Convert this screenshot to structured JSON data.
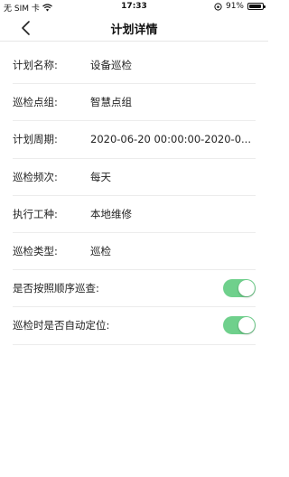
{
  "status_bar": {
    "carrier": "无 SIM 卡",
    "time": "17:33",
    "battery_text": "91%",
    "battery_level": 0.91
  },
  "nav": {
    "title": "计划详情"
  },
  "fields": [
    {
      "label": "计划名称:",
      "value": "设备巡检"
    },
    {
      "label": "巡检点组:",
      "value": "智慧点组"
    },
    {
      "label": "计划周期:",
      "value": "2020-06-20 00:00:00-2020-0..."
    },
    {
      "label": "巡检频次:",
      "value": "每天"
    },
    {
      "label": "执行工种:",
      "value": "本地维修"
    },
    {
      "label": "巡检类型:",
      "value": "巡检"
    }
  ],
  "toggles": [
    {
      "label": "是否按照顺序巡查:",
      "on": true
    },
    {
      "label": "巡检时是否自动定位:",
      "on": true
    }
  ],
  "colors": {
    "toggle_on": "#6fd08c",
    "divider": "#ececec"
  }
}
